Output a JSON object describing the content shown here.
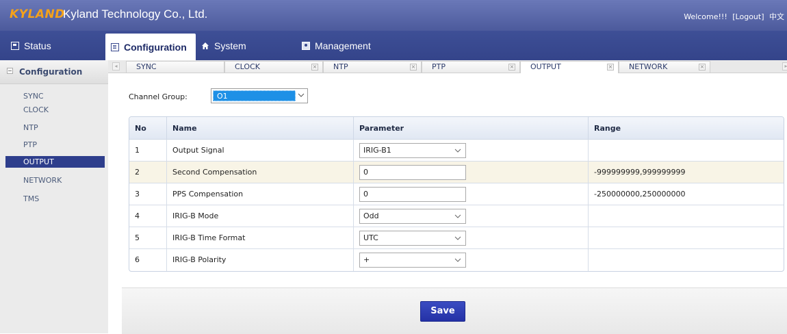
{
  "header": {
    "logo": "KYLAND",
    "company": "Kyland Technology Co., Ltd.",
    "welcome": "Welcome!!!",
    "logout": "[Logout]",
    "language": "中文"
  },
  "menu": {
    "status": "Status",
    "configuration": "Configuration",
    "system": "System",
    "management": "Management"
  },
  "sidebar": {
    "header": "Configuration",
    "items": [
      {
        "label": "SYNC"
      },
      {
        "label": "CLOCK"
      },
      {
        "label": "NTP"
      },
      {
        "label": "PTP"
      },
      {
        "label": "OUTPUT"
      },
      {
        "label": "NETWORK"
      },
      {
        "label": "TMS"
      }
    ],
    "active": "OUTPUT"
  },
  "tabs": [
    {
      "label": "SYNC"
    },
    {
      "label": "CLOCK"
    },
    {
      "label": "NTP"
    },
    {
      "label": "PTP"
    },
    {
      "label": "OUTPUT"
    },
    {
      "label": "NETWORK"
    }
  ],
  "channel_group": {
    "label": "Channel Group:",
    "value": "O1"
  },
  "table": {
    "headers": [
      "No",
      "Name",
      "Parameter",
      "Range"
    ],
    "rows": [
      {
        "no": "1",
        "name": "Output Signal",
        "param": "IRIG-B1",
        "param_type": "select",
        "range": ""
      },
      {
        "no": "2",
        "name": "Second Compensation",
        "param": "0",
        "param_type": "input",
        "range": "-999999999,999999999"
      },
      {
        "no": "3",
        "name": "PPS Compensation",
        "param": "0",
        "param_type": "input",
        "range": "-250000000,250000000"
      },
      {
        "no": "4",
        "name": "IRIG-B Mode",
        "param": "Odd",
        "param_type": "select",
        "range": ""
      },
      {
        "no": "5",
        "name": "IRIG-B Time Format",
        "param": "UTC",
        "param_type": "select",
        "range": ""
      },
      {
        "no": "6",
        "name": "IRIG-B Polarity",
        "param": "+",
        "param_type": "select",
        "range": ""
      }
    ]
  },
  "save_label": "Save",
  "colors": {
    "header": "#4c5a9c",
    "menubar": "#34448a",
    "logo": "#f5a21a",
    "active_nav": "#2e3e8c",
    "select_highlight": "#1e90e6",
    "save_button": "#2a38b0",
    "highlight_row": "#f8f4e6"
  }
}
